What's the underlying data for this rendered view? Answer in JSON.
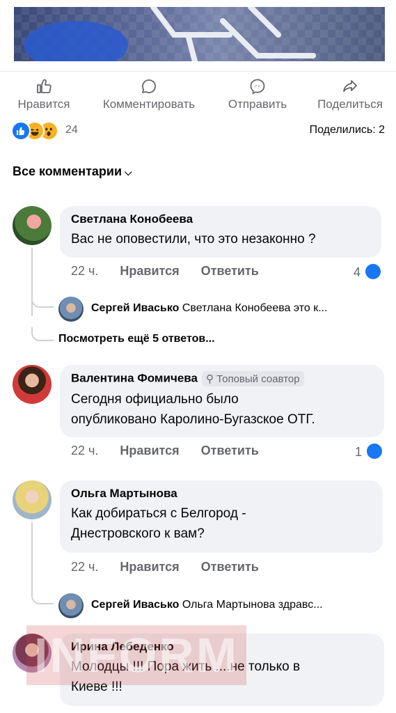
{
  "post_actions": {
    "like": "Нравится",
    "comment": "Комментировать",
    "send": "Отправить",
    "share": "Поделиться"
  },
  "reactions": {
    "icons": [
      "like-icon",
      "haha-icon",
      "wow-icon"
    ],
    "count": "24",
    "shares": "Поделились: 2"
  },
  "comments_filter": "Все комментарии",
  "comments": [
    {
      "author": "Светлана Конобеева",
      "text": "Вас не оповестили, что это незаконно ?",
      "time": "22 ч.",
      "like": "Нравится",
      "reply": "Ответить",
      "likes": "4",
      "replies": [
        {
          "author": "Сергей Ивасько",
          "text": "Светлана Конобеева это к..."
        }
      ],
      "more_replies": "Посмотреть ещё 5 ответов..."
    },
    {
      "author": "Валентина Фомичева",
      "badge": "Топовый соавтор",
      "text_lines": [
        "Сегодня официально было",
        "опубликовано Каролино-Бугазское ОТГ."
      ],
      "time": "22 ч.",
      "like": "Нравится",
      "reply": "Ответить",
      "likes": "1"
    },
    {
      "author": "Ольга Мартынова",
      "text_lines": [
        "Как добираться с Белгород -",
        "Днестровского к вам?"
      ],
      "time": "22 ч.",
      "like": "Нравится",
      "reply": "Ответить",
      "replies": [
        {
          "author": "Сергей Ивасько",
          "text": "Ольга Мартынова здравс..."
        }
      ]
    },
    {
      "author": "Ирина Лебеденко",
      "text_lines": [
        "Молодцы !!! Пора жить ....не только в",
        "Киеве !!!"
      ]
    }
  ],
  "watermark": "INFORM",
  "colors": {
    "accent": "#1877f2",
    "bubble": "#f0f2f5",
    "secondary_text": "#65676b"
  }
}
